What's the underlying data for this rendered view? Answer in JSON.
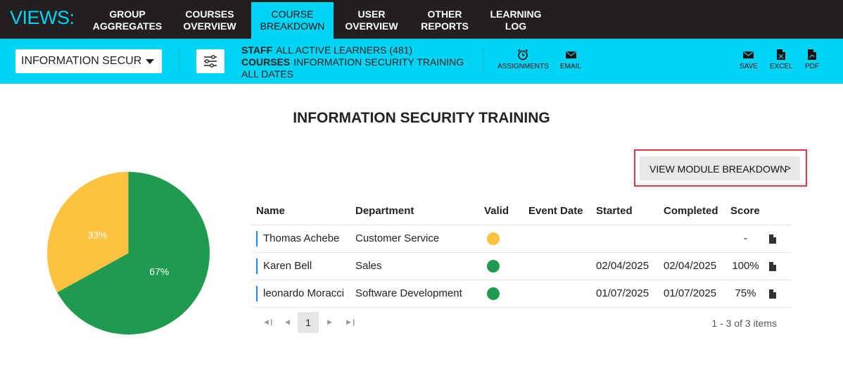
{
  "nav": {
    "views_label": "VIEWS:",
    "tabs": [
      {
        "line1": "GROUP",
        "line2": "AGGREGATES"
      },
      {
        "line1": "COURSES",
        "line2": "OVERVIEW"
      },
      {
        "line1": "COURSE",
        "line2": "BREAKDOWN",
        "active": true
      },
      {
        "line1": "USER",
        "line2": "OVERVIEW"
      },
      {
        "line1": "OTHER",
        "line2": "REPORTS"
      },
      {
        "line1": "LEARNING",
        "line2": "LOG"
      }
    ]
  },
  "toolbar": {
    "course_select_value": "INFORMATION SECUR",
    "filter": {
      "staff_key": "STAFF",
      "staff_value": "ALL ACTIVE LEARNERS (481)",
      "courses_key": "COURSES",
      "courses_value": "INFORMATION SECURITY TRAINING",
      "dates_value": "ALL DATES"
    },
    "assignments_label": "ASSIGNMENTS",
    "email_label": "EMAIL",
    "save_label": "SAVE",
    "excel_label": "EXCEL",
    "pdf_label": "PDF"
  },
  "main": {
    "title": "INFORMATION SECURITY TRAINING",
    "module_button_label": "VIEW MODULE BREAKDOWN",
    "module_button_chevron": ">"
  },
  "chart_data": {
    "type": "pie",
    "slices": [
      {
        "label": "67%",
        "value": 67,
        "color": "#1e9b4f"
      },
      {
        "label": "33%",
        "value": 33,
        "color": "#fdc23f"
      }
    ]
  },
  "table": {
    "columns": [
      "Name",
      "Department",
      "Valid",
      "Event Date",
      "Started",
      "Completed",
      "Score"
    ],
    "rows": [
      {
        "name": "Thomas Achebe",
        "department": "Customer Service",
        "valid_color": "#fdc23f",
        "event_date": "",
        "started": "",
        "completed": "",
        "score": "-"
      },
      {
        "name": "Karen Bell",
        "department": "Sales",
        "valid_color": "#1e9b4f",
        "event_date": "",
        "started": "02/04/2025",
        "completed": "02/04/2025",
        "score": "100%"
      },
      {
        "name": "leonardo Moracci",
        "department": "Software Development",
        "valid_color": "#1e9b4f",
        "event_date": "",
        "started": "01/07/2025",
        "completed": "01/07/2025",
        "score": "75%"
      }
    ]
  },
  "pager": {
    "current_page": "1",
    "info": "1 - 3 of 3 items"
  }
}
